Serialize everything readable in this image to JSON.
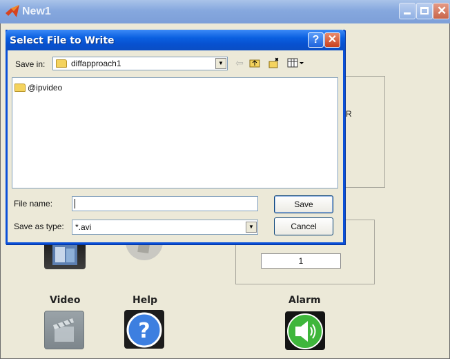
{
  "main_window": {
    "title": "New1",
    "panel_letter": "R",
    "value_box": "1",
    "labels": {
      "video": "Video",
      "help": "Help",
      "alarm": "Alarm"
    },
    "icons": [
      "matlab-icon",
      "minimize-icon",
      "maximize-icon",
      "close-icon",
      "video-icon",
      "help-icon",
      "alarm-speaker-icon"
    ]
  },
  "dialog": {
    "title": "Select File to Write",
    "help_button": "?",
    "close_button": "✕",
    "save_in_label": "Save in:",
    "save_in_value": "diffapproach1",
    "toolbar_icons": [
      "back-arrow-icon",
      "up-folder-icon",
      "new-folder-icon",
      "view-menu-icon"
    ],
    "files": [
      {
        "name": "@ipvideo",
        "type": "folder"
      }
    ],
    "file_name_label": "File name:",
    "file_name_value": "",
    "save_as_type_label": "Save as type:",
    "save_as_type_value": "*.avi",
    "save_button": "Save",
    "cancel_button": "Cancel"
  },
  "colors": {
    "xp_blue": "#0a5fe0",
    "face": "#ece9d8",
    "alarm_green": "#3fb63c",
    "help_blue": "#3d7fe0"
  }
}
